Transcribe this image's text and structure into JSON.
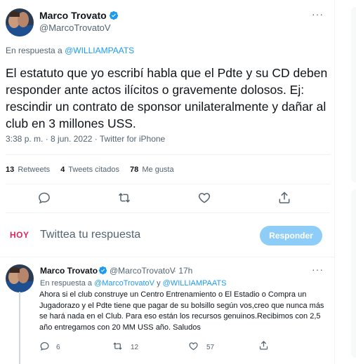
{
  "tweet": {
    "author_name": "Marco Trovato",
    "author_handle": "@MarcoTrovatoV",
    "replying_prefix": "En respuesta a ",
    "replying_to": "@WILLIAMPAATS",
    "text": "El estatuto que yo escribí habla que el Pdte y su CD deben responder ante actos ilícitos o gravemente dolosos. Ej: rescindir un contrato de sponsor unilateralmente y dañar al club en 3 millones USS.",
    "time": "3:38 p. m. · 8 jun. 2022 · Twitter for iPhone",
    "stats": {
      "retweets_count": "13",
      "retweets_label": "Retweets",
      "quotes_count": "4",
      "quotes_label": "Tweets citados",
      "likes_count": "78",
      "likes_label": "Me gusta"
    }
  },
  "composer": {
    "badge": "HOY",
    "placeholder": "Twittea tu respuesta",
    "button_label": "Responder"
  },
  "reply": {
    "author_name": "Marco Trovato",
    "author_handle": "@MarcoTrovatoV",
    "age": "· 17h",
    "replying_prefix": "En respuesta a ",
    "replying_to_1": "@MarcoTrovatoV",
    "replying_and": " y ",
    "replying_to_2": "@WILLIAMPAATS",
    "text": "Ahora si el club construye un Centro Entrenamiento o El Estadio o Compra un Jugadorazo y el Pdte tiene que pagar de su bolsillo según vos,creo que nunca más se hará nada en el Club. Para eso están los recursos genuinos.Recibimos con 2,5 año entregamos con 20 MM USS año. Saludos",
    "reply_count": "6",
    "retweet_count": "12",
    "like_count": "57"
  },
  "icons": [
    "verified-badge-icon",
    "more-icon",
    "reply-icon",
    "retweet-icon",
    "like-icon",
    "share-icon"
  ],
  "colors": {
    "accent": "#1d9bf0",
    "button_disabled": "#8ecdf8",
    "muted": "#536471",
    "hoy": "#e0245e"
  }
}
